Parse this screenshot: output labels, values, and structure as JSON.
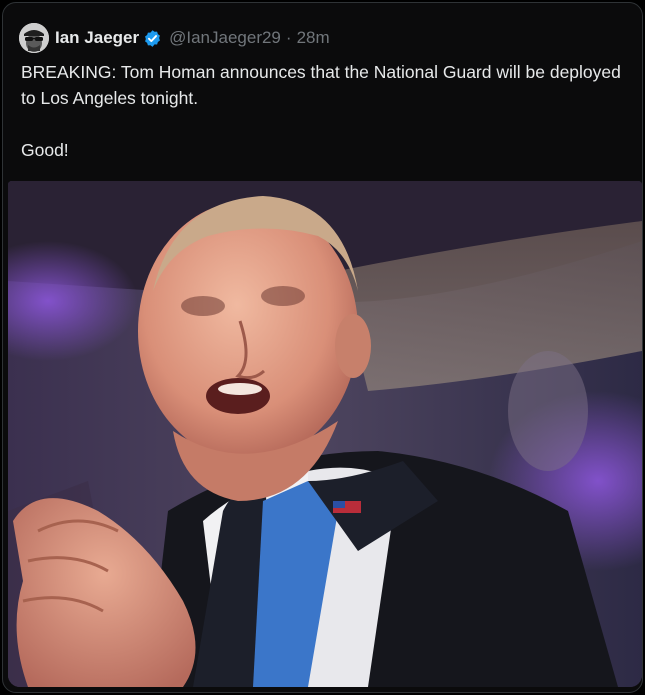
{
  "tweet": {
    "author_name": "Ian Jaeger",
    "handle": "@IanJaeger29",
    "separator": "·",
    "timestamp": "28m",
    "text_line_1": "BREAKING: Tom Homan announces that the National Guard will be deployed to Los Angeles tonight.",
    "text_line_2": "Good!",
    "verified": true,
    "avatar_icon": "sunglasses-cap-avatar",
    "media_description_icon": "speaker-photo"
  },
  "colors": {
    "background": "#000000",
    "card": "#0b0b0c",
    "text_primary": "#e7e9ea",
    "text_secondary": "#71767b",
    "verified_blue": "#1d9bf0"
  }
}
